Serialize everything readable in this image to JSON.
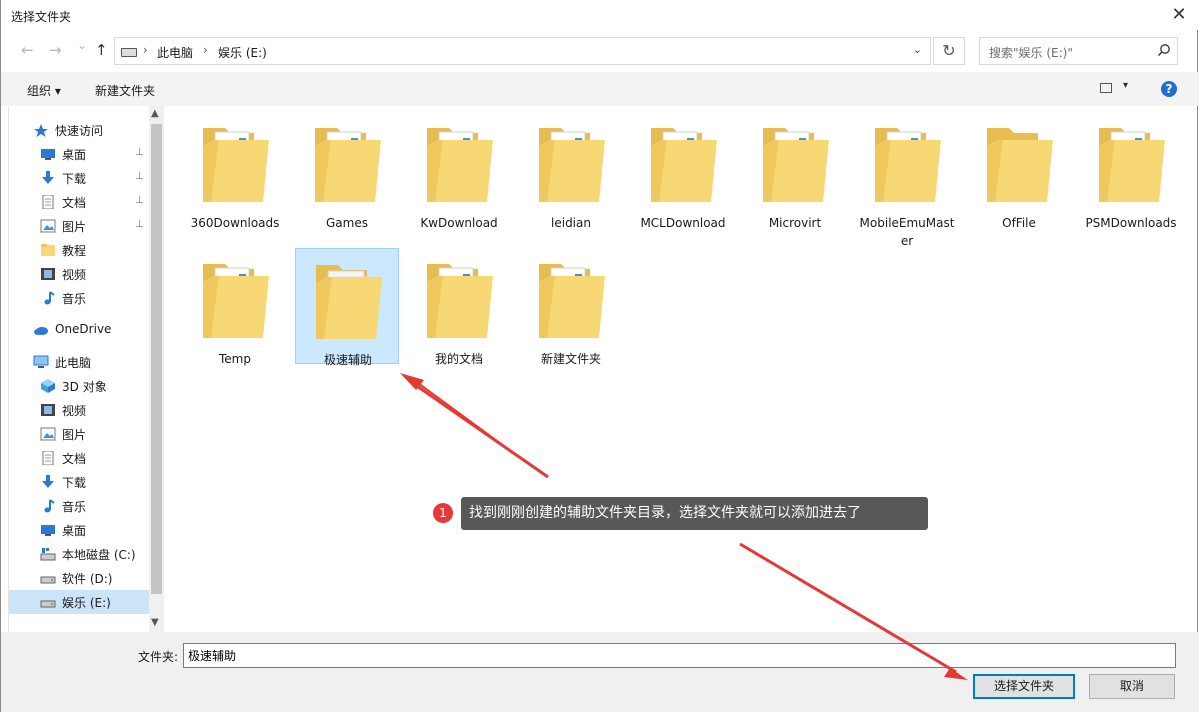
{
  "window": {
    "title": "选择文件夹",
    "close_glyph": "✕"
  },
  "nav": {
    "back_glyph": "←",
    "forward_glyph": "→",
    "recent_glyph": "⌄",
    "up_glyph": "↑",
    "breadcrumb": [
      "此电脑",
      "娱乐 (E:)"
    ],
    "separator": "›",
    "dropdown_glyph": "⌄",
    "refresh_glyph": "↻"
  },
  "search": {
    "placeholder": "搜索\"娱乐 (E:)\""
  },
  "toolbar": {
    "organize": "组织 ▾",
    "new_folder": "新建文件夹",
    "help": "?",
    "view_dropdown": "▾"
  },
  "sidebar": {
    "items": [
      {
        "label": "快速访问",
        "icon": "star-icon",
        "indent": 0,
        "pinned": false
      },
      {
        "label": "桌面",
        "icon": "desktop-icon",
        "indent": 1,
        "pinned": true
      },
      {
        "label": "下载",
        "icon": "download-icon",
        "indent": 1,
        "pinned": true
      },
      {
        "label": "文档",
        "icon": "document-icon",
        "indent": 1,
        "pinned": true
      },
      {
        "label": "图片",
        "icon": "picture-icon",
        "indent": 1,
        "pinned": true
      },
      {
        "label": "教程",
        "icon": "folder-icon",
        "indent": 1,
        "pinned": false
      },
      {
        "label": "视频",
        "icon": "video-icon",
        "indent": 1,
        "pinned": false
      },
      {
        "label": "音乐",
        "icon": "music-icon",
        "indent": 1,
        "pinned": false
      },
      {
        "label": "OneDrive",
        "icon": "cloud-icon",
        "indent": 0,
        "pinned": false
      },
      {
        "label": "此电脑",
        "icon": "computer-icon",
        "indent": 0,
        "pinned": false
      },
      {
        "label": "3D 对象",
        "icon": "cube-icon",
        "indent": 1,
        "pinned": false
      },
      {
        "label": "视频",
        "icon": "video-icon",
        "indent": 1,
        "pinned": false
      },
      {
        "label": "图片",
        "icon": "picture-icon",
        "indent": 1,
        "pinned": false
      },
      {
        "label": "文档",
        "icon": "document-icon",
        "indent": 1,
        "pinned": false
      },
      {
        "label": "下载",
        "icon": "download-icon",
        "indent": 1,
        "pinned": false
      },
      {
        "label": "音乐",
        "icon": "music-icon",
        "indent": 1,
        "pinned": false
      },
      {
        "label": "桌面",
        "icon": "desktop-icon",
        "indent": 1,
        "pinned": false
      },
      {
        "label": "本地磁盘 (C:)",
        "icon": "system-drive-icon",
        "indent": 1,
        "pinned": false
      },
      {
        "label": "软件 (D:)",
        "icon": "drive-icon",
        "indent": 1,
        "pinned": false
      },
      {
        "label": "娱乐 (E:)",
        "icon": "drive-icon",
        "indent": 1,
        "pinned": false,
        "active": true
      }
    ],
    "pin_glyph": "📌"
  },
  "folders": [
    {
      "name": "360Downloads",
      "kind": "docs"
    },
    {
      "name": "Games",
      "kind": "docs"
    },
    {
      "name": "KwDownload",
      "kind": "docs"
    },
    {
      "name": "leidian",
      "kind": "docs"
    },
    {
      "name": "MCLDownload",
      "kind": "docs"
    },
    {
      "name": "Microvirt",
      "kind": "docs"
    },
    {
      "name": "MobileEmuMaster",
      "kind": "docs"
    },
    {
      "name": "OfFile",
      "kind": "empty"
    },
    {
      "name": "PSMDownloads",
      "kind": "docs"
    },
    {
      "name": "Temp",
      "kind": "docs"
    },
    {
      "name": "极速辅助",
      "kind": "paper",
      "selected": true
    },
    {
      "name": "我的文档",
      "kind": "docs"
    },
    {
      "name": "新建文件夹",
      "kind": "docs"
    }
  ],
  "footer": {
    "folder_label": "文件夹:",
    "folder_value": "极速辅助",
    "select_button": "选择文件夹",
    "cancel_button": "取消"
  },
  "annotation": {
    "number": "1",
    "text": "找到刚刚创建的辅助文件夹目录，选择文件夹就可以添加进去了"
  },
  "colors": {
    "accent": "#0078d7",
    "selection": "#cce8ff",
    "folder": "#f8d775",
    "arrow": "#e53935"
  }
}
